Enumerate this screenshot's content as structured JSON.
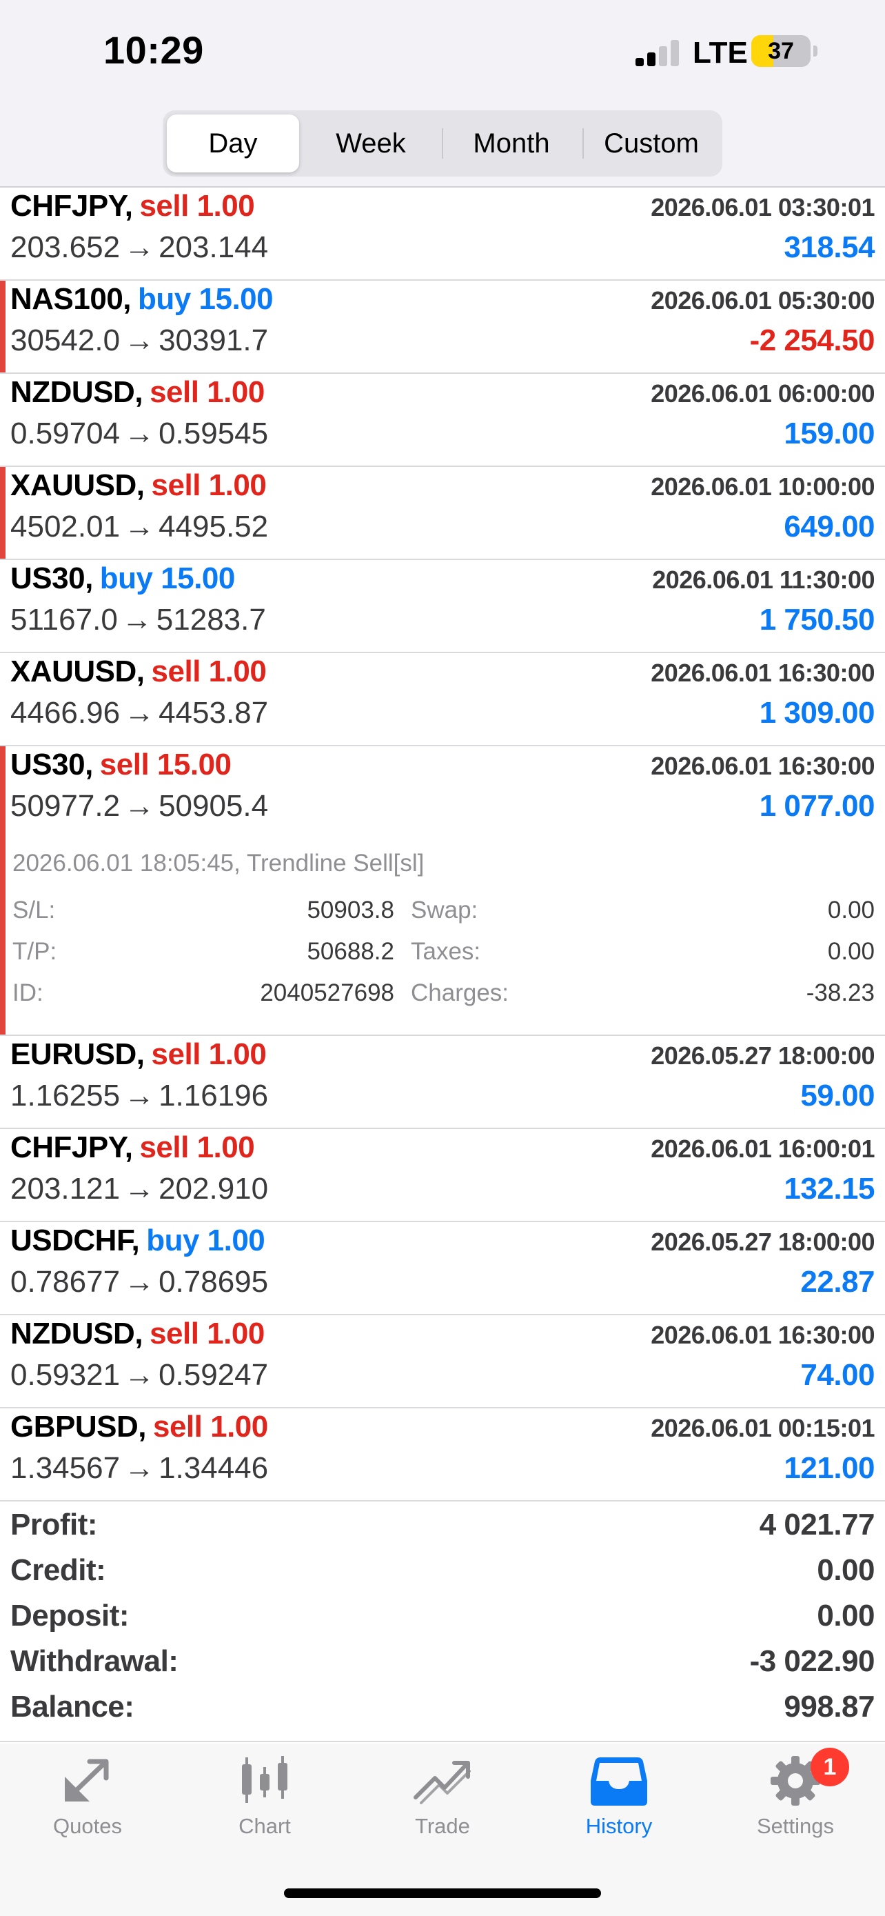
{
  "status_bar": {
    "time": "10:29",
    "network": "LTE",
    "battery": "37",
    "battery_level": 0.37
  },
  "segmented": {
    "tabs": [
      "Day",
      "Week",
      "Month",
      "Custom"
    ],
    "selected": "Day"
  },
  "trades": [
    {
      "symbol": "CHFJPY,",
      "direction": "sell 1.00",
      "side": "sell",
      "time": "2026.06.01 03:30:01",
      "open": "203.652",
      "close": "203.144",
      "profit": "318.54",
      "profit_sign": "pos",
      "marked": false
    },
    {
      "symbol": "NAS100,",
      "direction": "buy 15.00",
      "side": "buy",
      "time": "2026.06.01 05:30:00",
      "open": "30542.0",
      "close": "30391.7",
      "profit": "-2 254.50",
      "profit_sign": "neg",
      "marked": true
    },
    {
      "symbol": "NZDUSD,",
      "direction": "sell 1.00",
      "side": "sell",
      "time": "2026.06.01 06:00:00",
      "open": "0.59704",
      "close": "0.59545",
      "profit": "159.00",
      "profit_sign": "pos",
      "marked": false
    },
    {
      "symbol": "XAUUSD,",
      "direction": "sell 1.00",
      "side": "sell",
      "time": "2026.06.01 10:00:00",
      "open": "4502.01",
      "close": "4495.52",
      "profit": "649.00",
      "profit_sign": "pos",
      "marked": true
    },
    {
      "symbol": "US30,",
      "direction": "buy 15.00",
      "side": "buy",
      "time": "2026.06.01 11:30:00",
      "open": "51167.0",
      "close": "51283.7",
      "profit": "1 750.50",
      "profit_sign": "pos",
      "marked": false
    },
    {
      "symbol": "XAUUSD,",
      "direction": "sell 1.00",
      "side": "sell",
      "time": "2026.06.01 16:30:00",
      "open": "4466.96",
      "close": "4453.87",
      "profit": "1 309.00",
      "profit_sign": "pos",
      "marked": false
    },
    {
      "symbol": "US30,",
      "direction": "sell 15.00",
      "side": "sell",
      "time": "2026.06.01 16:30:00",
      "open": "50977.2",
      "close": "50905.4",
      "profit": "1 077.00",
      "profit_sign": "pos",
      "marked": true,
      "details": {
        "comment": "2026.06.01 18:05:45, Trendline Sell[sl]",
        "sl_label": "S/L:",
        "sl_value": "50903.8",
        "tp_label": "T/P:",
        "tp_value": "50688.2",
        "id_label": "ID:",
        "id_value": "2040527698",
        "swap_label": "Swap:",
        "swap_value": "0.00",
        "taxes_label": "Taxes:",
        "taxes_value": "0.00",
        "charges_label": "Charges:",
        "charges_value": "-38.23"
      }
    },
    {
      "symbol": "EURUSD,",
      "direction": "sell 1.00",
      "side": "sell",
      "time": "2026.05.27 18:00:00",
      "open": "1.16255",
      "close": "1.16196",
      "profit": "59.00",
      "profit_sign": "pos",
      "marked": false
    },
    {
      "symbol": "CHFJPY,",
      "direction": "sell 1.00",
      "side": "sell",
      "time": "2026.06.01 16:00:01",
      "open": "203.121",
      "close": "202.910",
      "profit": "132.15",
      "profit_sign": "pos",
      "marked": false
    },
    {
      "symbol": "USDCHF,",
      "direction": "buy 1.00",
      "side": "buy",
      "time": "2026.05.27 18:00:00",
      "open": "0.78677",
      "close": "0.78695",
      "profit": "22.87",
      "profit_sign": "pos",
      "marked": false
    },
    {
      "symbol": "NZDUSD,",
      "direction": "sell 1.00",
      "side": "sell",
      "time": "2026.06.01 16:30:00",
      "open": "0.59321",
      "close": "0.59247",
      "profit": "74.00",
      "profit_sign": "pos",
      "marked": false
    },
    {
      "symbol": "GBPUSD,",
      "direction": "sell 1.00",
      "side": "sell",
      "time": "2026.06.01 00:15:01",
      "open": "1.34567",
      "close": "1.34446",
      "profit": "121.00",
      "profit_sign": "pos",
      "marked": false
    }
  ],
  "arrow": "→",
  "summary": [
    {
      "label": "Profit:",
      "value": "4 021.77"
    },
    {
      "label": "Credit:",
      "value": "0.00"
    },
    {
      "label": "Deposit:",
      "value": "0.00"
    },
    {
      "label": "Withdrawal:",
      "value": "-3 022.90"
    },
    {
      "label": "Balance:",
      "value": "998.87"
    }
  ],
  "tabbar": {
    "items": [
      {
        "label": "Quotes",
        "icon": "quotes-icon"
      },
      {
        "label": "Chart",
        "icon": "chart-icon"
      },
      {
        "label": "Trade",
        "icon": "trade-icon"
      },
      {
        "label": "History",
        "icon": "history-icon",
        "active": true
      },
      {
        "label": "Settings",
        "icon": "gear-icon",
        "badge": "1"
      }
    ]
  },
  "colors": {
    "sell": "#e0251c",
    "buy": "#0a7af5",
    "profit_positive": "#0a7af5",
    "profit_negative": "#e0251c",
    "accent": "#0a7af5",
    "marker": "#e0463e"
  }
}
